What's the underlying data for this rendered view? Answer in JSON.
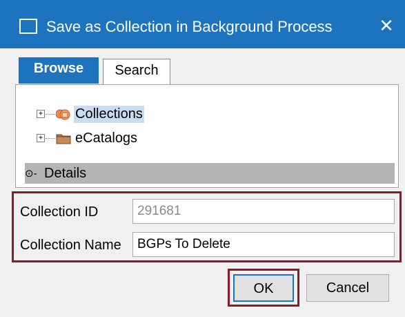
{
  "window": {
    "title": "Save as Collection in Background Process",
    "close_glyph": "✕",
    "accent_color": "#1e73be",
    "highlight_color": "#8b1a2b"
  },
  "tabs": [
    {
      "label": "Browse",
      "active": true
    },
    {
      "label": "Search",
      "active": false
    }
  ],
  "tree": [
    {
      "label": "Collections",
      "icon": "collections-icon",
      "selected": true
    },
    {
      "label": "eCatalogs",
      "icon": "folder-icon",
      "selected": false
    }
  ],
  "details": {
    "label": "Details"
  },
  "fields": {
    "collection_id_label": "Collection ID",
    "collection_id_value": "291681",
    "collection_name_label": "Collection Name",
    "collection_name_value": "BGPs To Delete"
  },
  "buttons": {
    "ok": "OK",
    "cancel": "Cancel"
  }
}
